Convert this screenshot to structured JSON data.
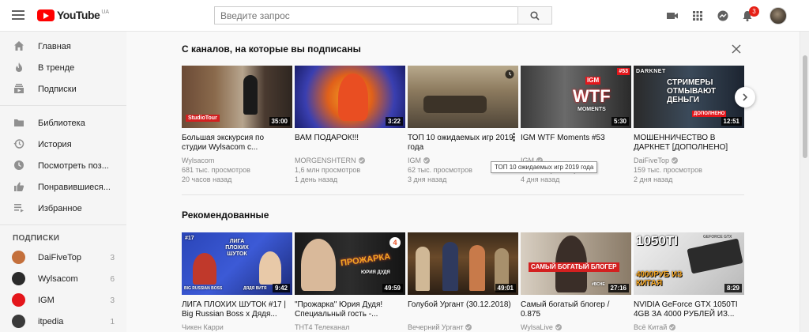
{
  "header": {
    "logo_text": "YouTube",
    "country": "UA",
    "search_placeholder": "Введите запрос",
    "notifications_count": "3"
  },
  "sidebar": {
    "main_items": [
      {
        "label": "Главная",
        "icon": "home-icon"
      },
      {
        "label": "В тренде",
        "icon": "flame-icon"
      },
      {
        "label": "Подписки",
        "icon": "subscriptions-icon"
      }
    ],
    "library_items": [
      {
        "label": "Библиотека",
        "icon": "folder-icon"
      },
      {
        "label": "История",
        "icon": "history-icon"
      },
      {
        "label": "Посмотреть поз...",
        "icon": "clock-icon"
      },
      {
        "label": "Понравившиеся...",
        "icon": "thumbs-up-icon"
      },
      {
        "label": "Избранное",
        "icon": "playlist-icon"
      }
    ],
    "subscriptions_heading": "ПОДПИСКИ",
    "subscriptions": [
      {
        "label": "DaiFiveTop",
        "count": "3",
        "color": "#c4703c"
      },
      {
        "label": "Wylsacom",
        "count": "6",
        "color": "#2b2b2b"
      },
      {
        "label": "IGM",
        "count": "3",
        "color": "#e4161b"
      },
      {
        "label": "itpedia",
        "count": "1",
        "color": "#3a3a3a"
      }
    ]
  },
  "sections": {
    "subscriptions_title": "С каналов, на которые вы подписаны",
    "recommended_title": "Рекомендованные"
  },
  "subscription_videos": [
    {
      "title": "Большая экскурсия по студии Wylsacom с...",
      "channel": "Wylsacom",
      "views": "681 тыс. просмотров",
      "age": "20 часов назад",
      "duration": "35:00",
      "overlay": "StudioTour"
    },
    {
      "title": "BAM ПОДАРОК!!!",
      "channel": "MORGENSHTERN",
      "views": "1,6 млн просмотров",
      "age": "1 день назад",
      "duration": "3:22",
      "overlay": ""
    },
    {
      "title": "ТОП 10 ожидаемых игр 2019 года",
      "channel": "IGM",
      "views": "62 тыс. просмотров",
      "age": "3 дня назад",
      "duration": "",
      "overlay": ""
    },
    {
      "title": "IGM WTF Moments #53",
      "channel": "IGM",
      "views": "62 тыс. просмотров",
      "age": "4 дня назад",
      "duration": "5:30",
      "overlay": "WTF",
      "overlay2": "MOMENTS",
      "tag": "#53",
      "brand": "IGM"
    },
    {
      "title": "МОШЕННИЧЕСТВО В ДАРКНЕТ [ДОПОЛНЕНО]",
      "channel": "DaiFiveTop",
      "views": "159 тыс. просмотров",
      "age": "2 дня назад",
      "duration": "12:51",
      "overlay": "СТРИМЕРЫ ОТМЫВАЮТ ДЕНЬГИ",
      "brand": "DARKNET",
      "tag": "ДОПОЛНЕНО"
    }
  ],
  "tooltip": "ТОП 10 ожидаемых игр 2019 года",
  "recommended_videos": [
    {
      "title": "ЛИГА ПЛОХИХ ШУТОК #17 | Big Russian Boss x Дядя...",
      "channel": "Чикен Карри",
      "duration": "9:42",
      "overlay": "ЛИГА ПЛОХИХ ШУТОК",
      "tag": "#17",
      "cap1": "BIG RUSSIAN BOSS",
      "cap2": "ДЯДЯ ВИТЯ"
    },
    {
      "title": "\"Прожарка\" Юрия Дудя! Специальный гость -...",
      "channel": "ТНТ4 Телеканал",
      "duration": "49:59",
      "overlay": "ПРОЖАРКА",
      "cap1": "ЮРИЯ ДУДЯ"
    },
    {
      "title": "Голубой Ургант (30.12.2018)",
      "channel": "Вечерний Ургант",
      "duration": "49:01",
      "overlay": ""
    },
    {
      "title": "Самый богатый блогер / 0.875",
      "channel": "WylsaLive",
      "duration": "27:16",
      "overlay": "САМЫЙ БОГАТЫЙ БЛОГЕР",
      "tag": "#ВСНЕ"
    },
    {
      "title": "NVIDIA GeForce GTX 1050TI 4GB ЗА 4000 РУБЛЕЙ ИЗ...",
      "channel": "Всё Китай",
      "duration": "8:29",
      "overlay": "1050TI",
      "overlay2": "4000РУБ ИЗ КИТАЯ",
      "brand": "GEFORCE GTX"
    }
  ]
}
